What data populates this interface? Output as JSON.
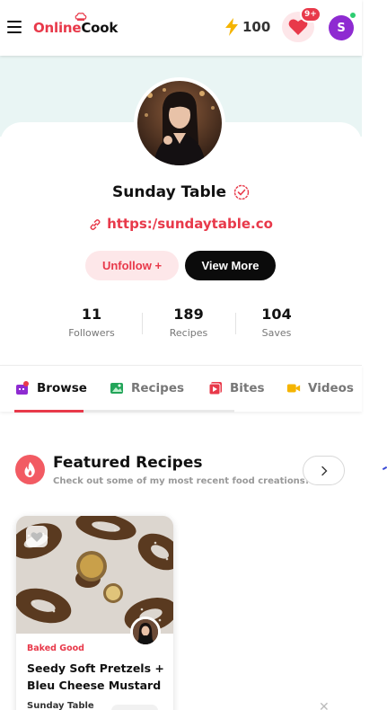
{
  "header": {
    "logo_part1": "Online",
    "logo_part2": "Cook",
    "energy_count": "100",
    "notif_badge": "9+",
    "user_initial": "S",
    "icons": [
      "menu-icon",
      "bolt-icon",
      "heart-icon"
    ]
  },
  "profile": {
    "name": "Sunday Table",
    "website": "https:/sundaytable.co",
    "unfollow_label": "Unfollow +",
    "view_more_label": "View More",
    "stats": [
      {
        "value": "11",
        "label": "Followers"
      },
      {
        "value": "189",
        "label": "Recipes"
      },
      {
        "value": "104",
        "label": "Saves"
      }
    ]
  },
  "tabs": [
    {
      "label": "Browse",
      "active": true
    },
    {
      "label": "Recipes",
      "active": false
    },
    {
      "label": "Bites",
      "active": false
    },
    {
      "label": "Videos",
      "active": false
    }
  ],
  "featured": {
    "title": "Featured Recipes",
    "subtitle": "Check out some of my most recent food creations!",
    "recipes": [
      {
        "category": "Baked Good",
        "title": "Seedy Soft Pretzels + Bleu Cheese Mustard",
        "author": "Sunday Table"
      }
    ]
  },
  "colors": {
    "brand_red": "#e8394a",
    "hero_bg": "#e9f5f4",
    "avatar_purple": "#8e2bd1",
    "online_green": "#2ecc71"
  }
}
